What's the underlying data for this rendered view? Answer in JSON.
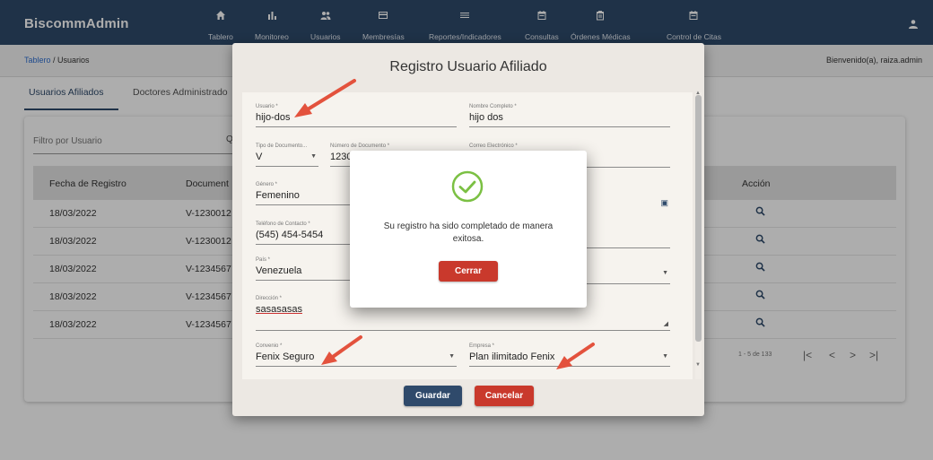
{
  "app": {
    "brand": "BiscommAdmin"
  },
  "nav": [
    {
      "label": "Tablero",
      "icon": "home-icon"
    },
    {
      "label": "Monitoreo",
      "icon": "bar-chart-icon"
    },
    {
      "label": "Usuarios",
      "icon": "users-icon"
    },
    {
      "label": "Membresías",
      "icon": "card-icon"
    },
    {
      "label": "Reportes/Indicadores",
      "icon": "list-icon"
    },
    {
      "label": "Consultas",
      "icon": "calendar-icon"
    },
    {
      "label": "Órdenes Médicas",
      "icon": "clipboard-icon"
    },
    {
      "label": "Control de Citas",
      "icon": "calendar-icon"
    }
  ],
  "breadcrumb": {
    "link": "Tablero",
    "current": " / Usuarios"
  },
  "welcome": "Bienvenido(a), raiza.admin",
  "tabs": [
    "Usuarios Afiliados",
    "Doctores Administrado"
  ],
  "filter": {
    "placeholder": "Filtro por Usuario",
    "search_label": "Q"
  },
  "table": {
    "headers": [
      "Fecha de Registro",
      "Document",
      "Acción"
    ],
    "rows": [
      {
        "date": "18/03/2022",
        "doc": "V-1230012"
      },
      {
        "date": "18/03/2022",
        "doc": "V-1230012"
      },
      {
        "date": "18/03/2022",
        "doc": "V-1234567"
      },
      {
        "date": "18/03/2022",
        "doc": "V-1234567"
      },
      {
        "date": "18/03/2022",
        "doc": "V-1234567"
      }
    ],
    "pager": {
      "range": "1 - 5 de 133",
      "first": "|<",
      "prev": "<",
      "next": ">",
      "last": ">|"
    }
  },
  "dialog": {
    "title": "Registro Usuario Afiliado",
    "fields": {
      "usuario": {
        "label": "Usuario *",
        "value": "hijo-dos"
      },
      "nombre": {
        "label": "Nombre Completo *",
        "value": "hijo dos"
      },
      "tipo_doc": {
        "label": "Tipo de Documento...",
        "value": "V"
      },
      "num_doc": {
        "label": "Número de Documento *",
        "value": "1230"
      },
      "correo": {
        "label": "Correo Electrónico *",
        "value": ""
      },
      "genero": {
        "label": "Género *",
        "value": "Femenino"
      },
      "telefono": {
        "label": "Teléfono de Contacto *",
        "value": "(545) 454-5454"
      },
      "pais": {
        "label": "País *",
        "value": "Venezuela"
      },
      "direccion": {
        "label": "Dirección *",
        "value": "sasasasas"
      },
      "convenio": {
        "label": "Convenio *",
        "value": "Fenix Seguro"
      },
      "empresa": {
        "label": "Empresa *",
        "value": "Plan ilimitado Fenix"
      }
    },
    "save": "Guardar",
    "cancel": "Cancelar"
  },
  "popup": {
    "message": "Su registro ha sido completado de manera exitosa.",
    "close": "Cerrar"
  },
  "colors": {
    "navbar": "#2f4a6b",
    "danger": "#c9392c",
    "success": "#7bc043",
    "arrow": "#e3523d"
  }
}
